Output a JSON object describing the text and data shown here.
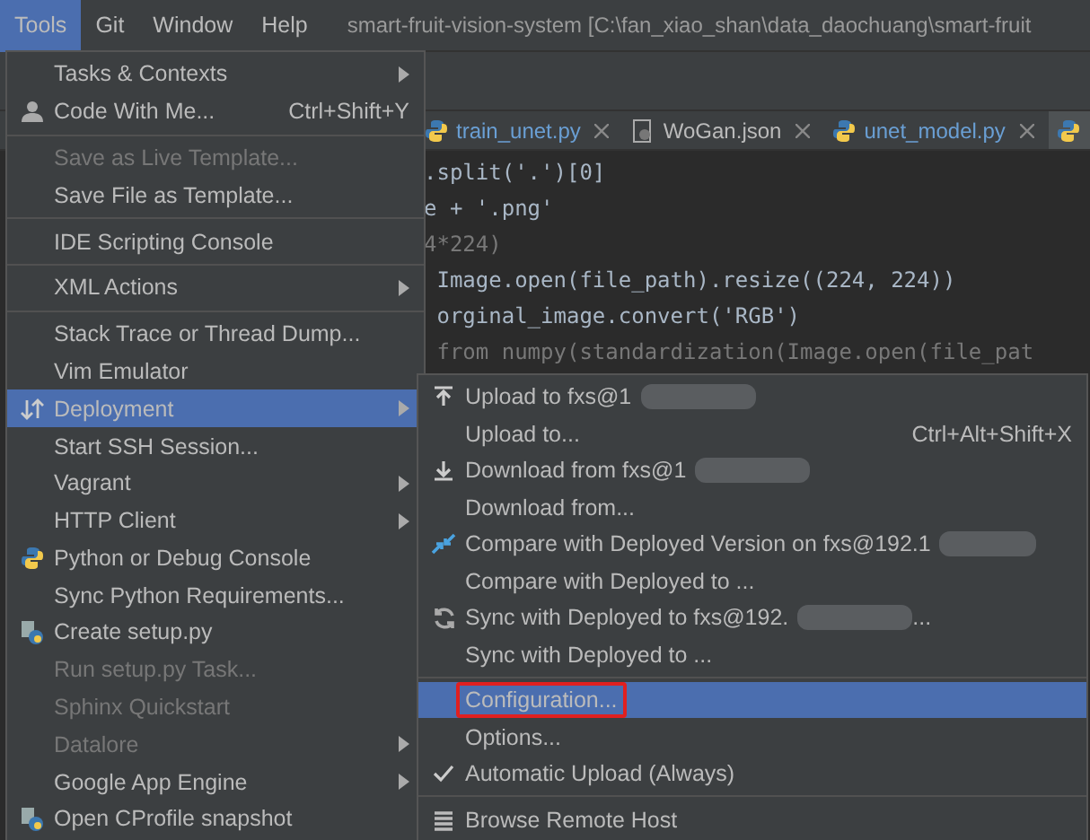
{
  "menu_bar": {
    "items": [
      {
        "label": "Tools",
        "selected": true
      },
      {
        "label": "Git",
        "selected": false
      },
      {
        "label": "Window",
        "selected": false
      },
      {
        "label": "Help",
        "selected": false
      }
    ],
    "title": "smart-fruit-vision-system [C:\\fan_xiao_shan\\data_daochuang\\smart-fruit"
  },
  "editor": {
    "tabs": [
      {
        "label": "train_unet.py",
        "selected": false
      },
      {
        "label": "WoGan.json",
        "selected": false
      },
      {
        "label": "unet_model.py",
        "selected": false
      },
      {
        "selected": true
      }
    ],
    "lines": [
      {
        "text": ".split('.')[0]",
        "dim": false
      },
      {
        "text": "e + '.png'",
        "dim": false
      },
      {
        "text": "4*224)",
        "dim": true
      },
      {
        "text": " Image.open(file_path).resize((224, 224))",
        "dim": false
      },
      {
        "text": " orginal_image.convert('RGB')",
        "dim": false
      },
      {
        "text": " from numpy(standardization(Image.open(file_pat",
        "dim": true
      }
    ]
  },
  "tools_menu": [
    {
      "kind": "item",
      "label": "Tasks & Contexts",
      "submenu": true,
      "disabled": false,
      "selected": false
    },
    {
      "kind": "item",
      "label": "Code With Me...",
      "shortcut": "Ctrl+Shift+Y",
      "disabled": false,
      "selected": false
    },
    {
      "kind": "separator"
    },
    {
      "kind": "item",
      "label": "Save as Live Template...",
      "disabled": true,
      "selected": false
    },
    {
      "kind": "item",
      "label": "Save File as Template...",
      "disabled": false,
      "selected": false
    },
    {
      "kind": "separator"
    },
    {
      "kind": "item",
      "label": "IDE Scripting Console",
      "disabled": false,
      "selected": false
    },
    {
      "kind": "separator"
    },
    {
      "kind": "item",
      "label": "XML Actions",
      "submenu": true,
      "disabled": false,
      "selected": false
    },
    {
      "kind": "separator"
    },
    {
      "kind": "item",
      "label": "Stack Trace or Thread Dump...",
      "disabled": false,
      "selected": false
    },
    {
      "kind": "item",
      "label": "Vim Emulator",
      "disabled": false,
      "selected": false
    },
    {
      "kind": "item",
      "label": "Deployment",
      "submenu": true,
      "disabled": false,
      "selected": true
    },
    {
      "kind": "item",
      "label": "Start SSH Session...",
      "disabled": false,
      "selected": false
    },
    {
      "kind": "item",
      "label": "Vagrant",
      "submenu": true,
      "disabled": false,
      "selected": false
    },
    {
      "kind": "item",
      "label": "HTTP Client",
      "submenu": true,
      "disabled": false,
      "selected": false
    },
    {
      "kind": "item",
      "label": "Python or Debug Console",
      "disabled": false,
      "selected": false
    },
    {
      "kind": "item",
      "label": "Sync Python Requirements...",
      "disabled": false,
      "selected": false
    },
    {
      "kind": "item",
      "label": "Create setup.py",
      "disabled": false,
      "selected": false
    },
    {
      "kind": "item",
      "label": "Run setup.py Task...",
      "disabled": true,
      "selected": false
    },
    {
      "kind": "item",
      "label": "Sphinx Quickstart",
      "disabled": true,
      "selected": false
    },
    {
      "kind": "item",
      "label": "Datalore",
      "submenu": true,
      "disabled": true,
      "selected": false
    },
    {
      "kind": "item",
      "label": "Google App Engine",
      "submenu": true,
      "disabled": false,
      "selected": false
    },
    {
      "kind": "item",
      "label": "Open CProfile snapshot",
      "disabled": false,
      "selected": false
    }
  ],
  "deployment_menu": [
    {
      "kind": "item",
      "label": "Upload to fxs@1",
      "redacted": true,
      "selected": false
    },
    {
      "kind": "item",
      "label": "Upload to...",
      "shortcut": "Ctrl+Alt+Shift+X",
      "selected": false
    },
    {
      "kind": "item",
      "label": "Download from fxs@1",
      "redacted": true,
      "selected": false
    },
    {
      "kind": "item",
      "label": "Download from...",
      "selected": false
    },
    {
      "kind": "item",
      "label": "Compare with Deployed Version on fxs@192.1",
      "redacted": true,
      "selected": false
    },
    {
      "kind": "item",
      "label": "Compare with Deployed to ...",
      "selected": false
    },
    {
      "kind": "item",
      "label": "Sync with Deployed to fxs@192.",
      "redacted": true,
      "suffix": "...",
      "selected": false
    },
    {
      "kind": "item",
      "label": "Sync with Deployed to ...",
      "selected": false
    },
    {
      "kind": "separator"
    },
    {
      "kind": "item",
      "label": "Configuration...",
      "selected": true,
      "outlined": true
    },
    {
      "kind": "item",
      "label": "Options...",
      "selected": false
    },
    {
      "kind": "item",
      "label": "Automatic Upload (Always)",
      "checked": true,
      "selected": false
    },
    {
      "kind": "separator"
    },
    {
      "kind": "item",
      "label": "Browse Remote Host",
      "selected": false
    }
  ]
}
